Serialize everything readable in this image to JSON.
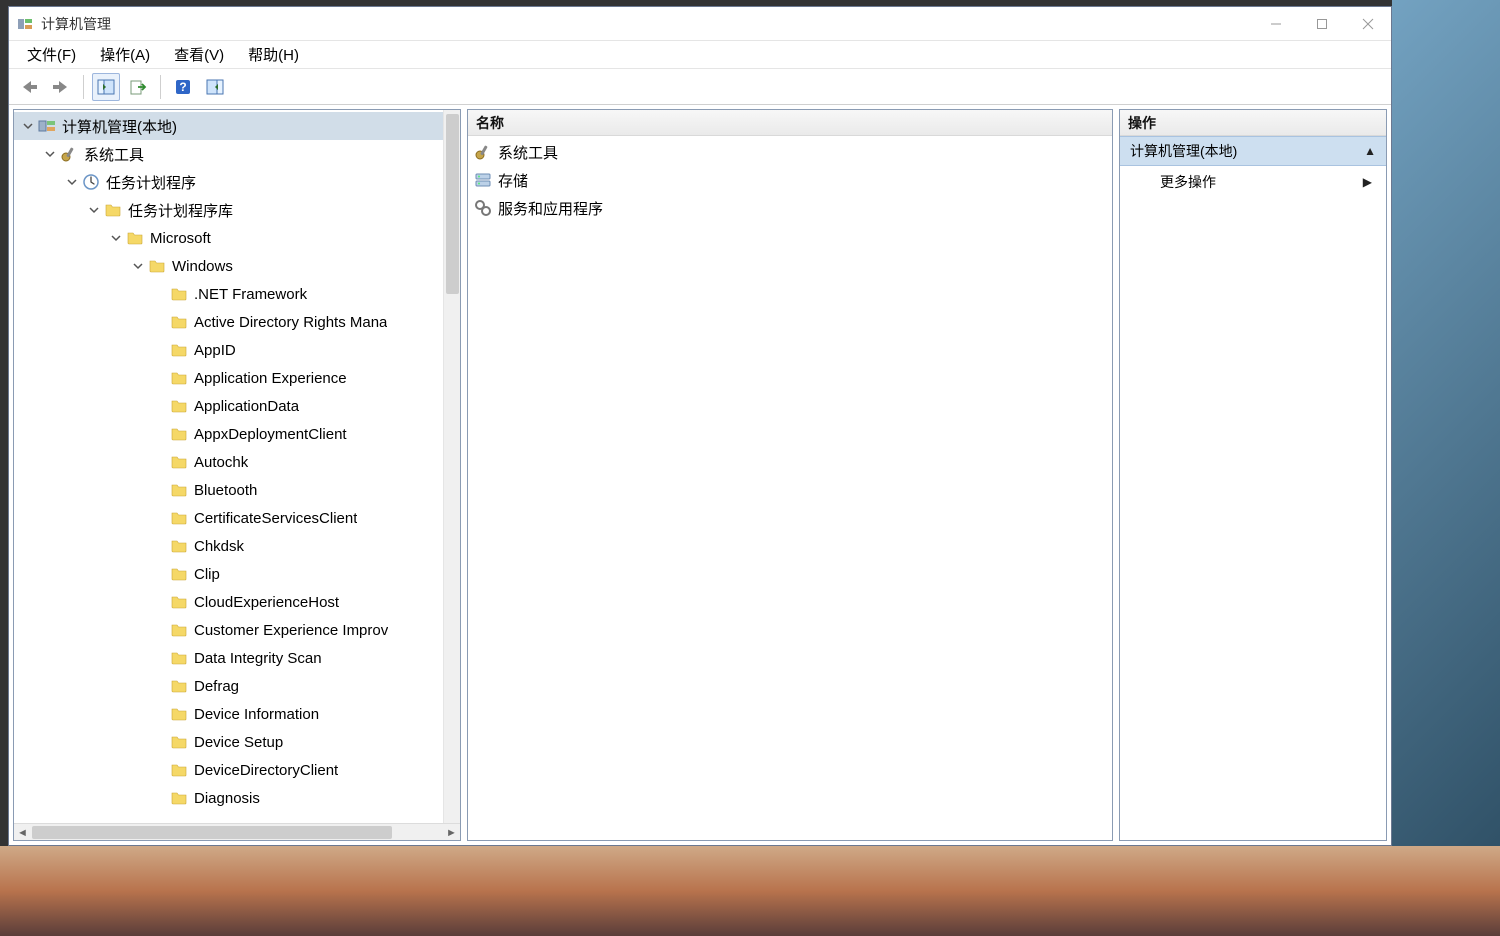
{
  "window": {
    "title": "计算机管理"
  },
  "menu": {
    "file": "文件(F)",
    "action": "操作(A)",
    "view": "查看(V)",
    "help": "帮助(H)"
  },
  "tree": {
    "root": "计算机管理(本地)",
    "system_tools": "系统工具",
    "task_sched": "任务计划程序",
    "task_sched_lib": "任务计划程序库",
    "microsoft": "Microsoft",
    "windows": "Windows",
    "children": [
      ".NET Framework",
      "Active Directory Rights Mana",
      "AppID",
      "Application Experience",
      "ApplicationData",
      "AppxDeploymentClient",
      "Autochk",
      "Bluetooth",
      "CertificateServicesClient",
      "Chkdsk",
      "Clip",
      "CloudExperienceHost",
      "Customer Experience Improv",
      "Data Integrity Scan",
      "Defrag",
      "Device Information",
      "Device Setup",
      "DeviceDirectoryClient",
      "Diagnosis"
    ]
  },
  "columns": {
    "name": "名称"
  },
  "center_items": [
    "系统工具",
    "存储",
    "服务和应用程序"
  ],
  "actions": {
    "panel_title": "操作",
    "section": "计算机管理(本地)",
    "more": "更多操作"
  }
}
